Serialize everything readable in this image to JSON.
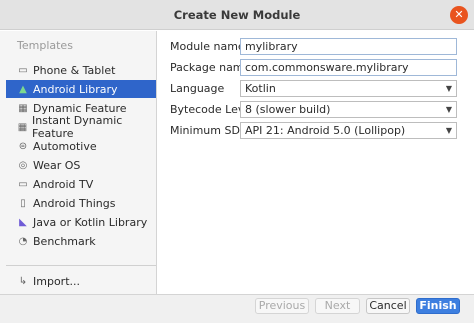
{
  "window": {
    "title": "Create New Module"
  },
  "sidebar": {
    "header": "Templates",
    "items": [
      {
        "label": "Phone & Tablet",
        "icon": "phone-tablet-icon",
        "selected": false
      },
      {
        "label": "Android Library",
        "icon": "android-icon",
        "selected": true
      },
      {
        "label": "Dynamic Feature",
        "icon": "dynamic-feature-icon",
        "selected": false
      },
      {
        "label": "Instant Dynamic Feature",
        "icon": "instant-feature-icon",
        "selected": false
      },
      {
        "label": "Automotive",
        "icon": "car-icon",
        "selected": false
      },
      {
        "label": "Wear OS",
        "icon": "watch-icon",
        "selected": false
      },
      {
        "label": "Android TV",
        "icon": "tv-icon",
        "selected": false
      },
      {
        "label": "Android Things",
        "icon": "things-icon",
        "selected": false
      },
      {
        "label": "Java or Kotlin Library",
        "icon": "kotlin-icon",
        "selected": false
      },
      {
        "label": "Benchmark",
        "icon": "benchmark-icon",
        "selected": false
      },
      {
        "label": "Import...",
        "icon": "import-icon",
        "selected": false
      }
    ]
  },
  "form": {
    "module_name": {
      "label": "Module name",
      "value": "mylibrary"
    },
    "package_name": {
      "label": "Package name",
      "value": "com.commonsware.mylibrary"
    },
    "language": {
      "label": "Language",
      "value": "Kotlin"
    },
    "bytecode_level": {
      "label": "Bytecode Level",
      "value": "8 (slower build)"
    },
    "minimum_sdk": {
      "label": "Minimum SDK",
      "value": "API 21: Android 5.0 (Lollipop)"
    }
  },
  "footer": {
    "previous": "Previous",
    "next": "Next",
    "cancel": "Cancel",
    "finish": "Finish"
  },
  "colors": {
    "selection": "#2f65ca",
    "primary_button": "#3d7fe0",
    "close_button": "#e9541f"
  }
}
